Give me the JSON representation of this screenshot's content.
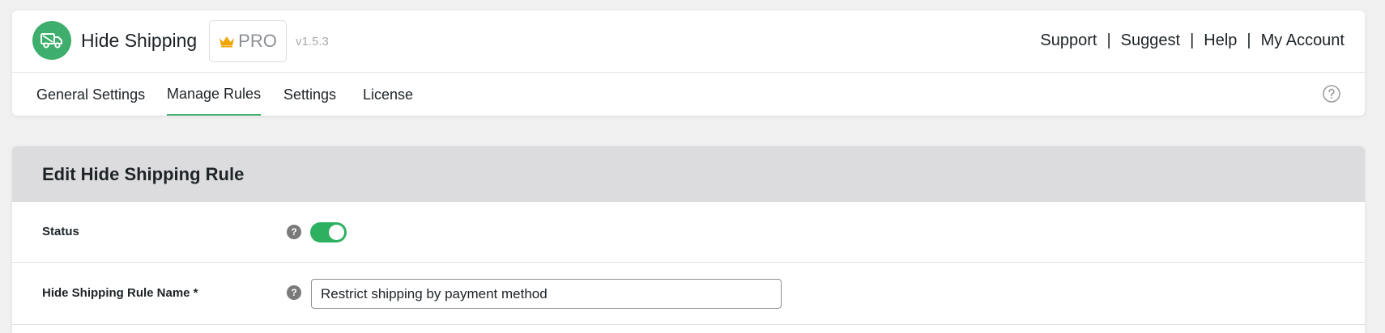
{
  "brand": {
    "title": "Hide Shipping",
    "logo_icon": "truck-icon",
    "accent_color": "#3dae6b",
    "pro_label": "PRO",
    "version": "v1.5.3"
  },
  "top_links": {
    "support": "Support",
    "suggest": "Suggest",
    "help": "Help",
    "my_account": "My Account",
    "separator": "|"
  },
  "tabs": [
    {
      "label": "General Settings",
      "active": false
    },
    {
      "label": "Manage Rules",
      "active": true
    },
    {
      "label": "Settings",
      "active": false
    },
    {
      "label": "License",
      "active": false
    }
  ],
  "edit_panel": {
    "title": "Edit Hide Shipping Rule",
    "status": {
      "label": "Status",
      "enabled": true,
      "help_glyph": "?"
    },
    "rule_name": {
      "label": "Hide Shipping Rule Name *",
      "value": "Restrict shipping by payment method",
      "help_glyph": "?"
    }
  }
}
